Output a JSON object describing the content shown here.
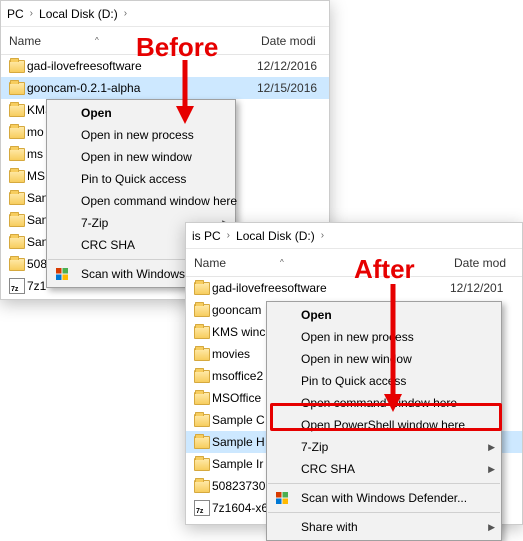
{
  "annotations": {
    "before_label": "Before",
    "after_label": "After"
  },
  "back": {
    "breadcrumb": {
      "part1": "PC",
      "part2": "Local Disk (D:)"
    },
    "cols": {
      "name": "Name",
      "date": "Date modi"
    },
    "rows": [
      {
        "name": "gad-ilovefreesoftware",
        "date": "12/12/2016",
        "sel": false
      },
      {
        "name": "gooncam-0.2.1-alpha",
        "date": "12/15/2016",
        "sel": true
      },
      {
        "name": "KMS",
        "date": "",
        "sel": false
      },
      {
        "name": "mo",
        "date": "",
        "sel": false
      },
      {
        "name": "ms",
        "date": "",
        "sel": false
      },
      {
        "name": "MS",
        "date": "",
        "sel": false
      },
      {
        "name": "San",
        "date": "",
        "sel": false
      },
      {
        "name": "San",
        "date": "",
        "sel": false
      },
      {
        "name": "San",
        "date": "",
        "sel": false
      },
      {
        "name": "508",
        "date": "",
        "sel": false
      }
    ],
    "zip_row": {
      "name": "7z1"
    },
    "menu": {
      "open": "Open",
      "open_process": "Open in new process",
      "open_window": "Open in new window",
      "pin": "Pin to Quick access",
      "open_cmd": "Open command window here",
      "seven_zip": "7-Zip",
      "crc": "CRC SHA",
      "defender": "Scan with Windows D"
    }
  },
  "front": {
    "breadcrumb": {
      "part1": "is PC",
      "part2": "Local Disk (D:)"
    },
    "cols": {
      "name": "Name",
      "date": "Date mod"
    },
    "rows": [
      {
        "name": "gad-ilovefreesoftware",
        "date": "12/12/201",
        "sel": false
      },
      {
        "name": "gooncam",
        "date": "",
        "sel": false
      },
      {
        "name": "KMS winc",
        "date": "",
        "sel": false
      },
      {
        "name": "movies",
        "date": "",
        "sel": false
      },
      {
        "name": "msoffice2",
        "date": "",
        "sel": false
      },
      {
        "name": "MSOffice",
        "date": "",
        "sel": false
      },
      {
        "name": "Sample C",
        "date": "",
        "sel": false
      },
      {
        "name": "Sample H",
        "date": "",
        "sel": true
      },
      {
        "name": "Sample Ir",
        "date": "",
        "sel": false
      },
      {
        "name": "50823730",
        "date": "",
        "sel": false
      }
    ],
    "zip_row": {
      "name": "7z1604-x6"
    },
    "menu": {
      "open": "Open",
      "open_process": "Open in new process",
      "open_window": "Open in new window",
      "pin": "Pin to Quick access",
      "open_cmd": "Open command window here",
      "open_ps": "Open PowerShell window here",
      "seven_zip": "7-Zip",
      "crc": "CRC SHA",
      "defender": "Scan with Windows Defender...",
      "share": "Share with"
    }
  }
}
